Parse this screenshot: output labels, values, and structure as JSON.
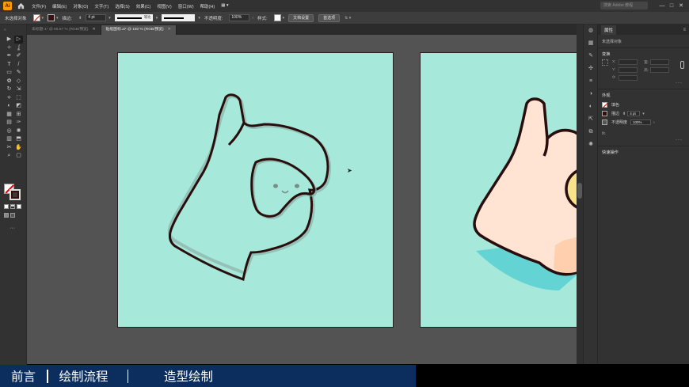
{
  "app": {
    "logo": "Ai",
    "menu": [
      "文件(F)",
      "编辑(E)",
      "对象(O)",
      "文字(T)",
      "选择(S)",
      "效果(C)",
      "视图(V)",
      "窗口(W)",
      "帮助(H)"
    ],
    "search_placeholder": "搜索 Adobe 教程",
    "window_controls": [
      "—",
      "□",
      "✕"
    ]
  },
  "control_bar": {
    "selection_label": "未选择对象",
    "stroke_label": "描边:",
    "stroke_weight": "4 pt",
    "stroke_profile": "等比",
    "opacity_label": "不透明度:",
    "opacity_value": "100%",
    "style_label": "样式:",
    "doc_setup_button": "文档设置",
    "preferences_button": "首选项"
  },
  "tabs": [
    {
      "label": "未标题-1* @ 66.67 % (RGB/预览)",
      "active": false
    },
    {
      "label": "贴纸图标.ai* @ 150 % (RGB/预览)",
      "active": true
    }
  ],
  "tools": [
    "selection-tool",
    "direct-selection-tool",
    "magic-wand-tool",
    "lasso-tool",
    "pen-tool",
    "curvature-tool",
    "type-tool",
    "line-tool",
    "rectangle-tool",
    "paintbrush-tool",
    "shaper-tool",
    "eraser-tool",
    "rotate-tool",
    "scale-tool",
    "width-tool",
    "free-transform-tool",
    "shape-builder-tool",
    "live-paint-tool",
    "perspective-tool",
    "mesh-tool",
    "gradient-tool",
    "eyedropper-tool",
    "blend-tool",
    "symbol-sprayer-tool",
    "column-graph-tool",
    "artboard-tool",
    "slice-tool",
    "hand-tool",
    "zoom-tool",
    "print-tiling-tool"
  ],
  "tool_glyphs": [
    "▶",
    "▷",
    "✧",
    "ʆ",
    "✒",
    "✐",
    "T",
    "/",
    "▭",
    "✎",
    "✿",
    "◇",
    "↻",
    "⇲",
    "⟡",
    "⬚",
    "◐",
    "◩",
    "▦",
    "⊞",
    "▤",
    "✑",
    "◎",
    "✺",
    "▥",
    "⬒",
    "✂",
    "✋",
    "⌕",
    "▢"
  ],
  "properties_panel": {
    "tab": "属性",
    "subtitle": "未选择对象",
    "transform_title": "变换",
    "x_label": "X:",
    "y_label": "Y:",
    "w_label": "宽:",
    "h_label": "高:",
    "appearance_title": "外观",
    "fill_label": "填色",
    "stroke_label": "描边",
    "stroke_weight": "4 pt",
    "opacity_label": "不透明度",
    "opacity_value": "100%",
    "fx_label": "fx.",
    "quick_actions_title": "快速操作"
  },
  "bottom_bar": {
    "items": [
      "前言",
      "绘制流程",
      "造型绘制"
    ]
  },
  "colors": {
    "artboard": "#a6e8d9",
    "outline": "#2a0d0d",
    "skin": "#ffe3d3",
    "skin_shadow": "#ffcfae",
    "teal_shadow": "#63d3d3",
    "face_yellow": "#f9e38a",
    "bottom_bar": "#0c2e5e"
  }
}
